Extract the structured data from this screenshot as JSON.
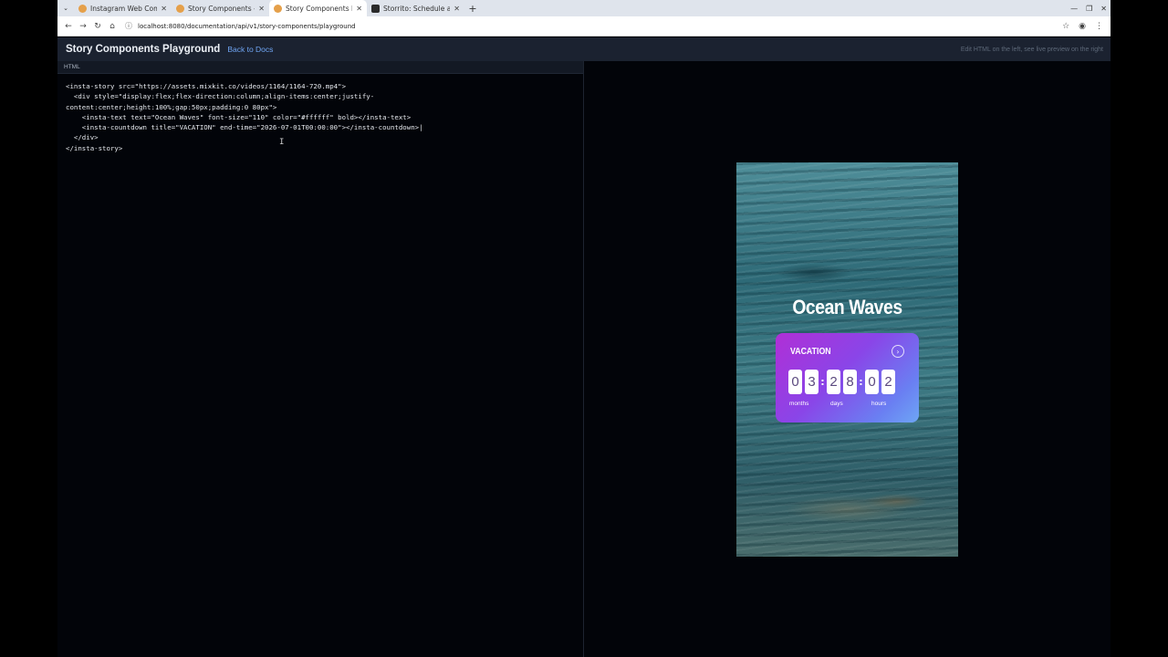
{
  "browser": {
    "tabs": [
      {
        "title": "Instagram Web Comp",
        "favicon": "instagram-icon"
      },
      {
        "title": "Story Components - S",
        "favicon": "instagram-icon"
      },
      {
        "title": "Story Components Pl",
        "favicon": "instagram-icon",
        "active": true
      },
      {
        "title": "Storrito: Schedule an",
        "favicon": "storrito-icon"
      }
    ],
    "url": "localhost:8080/documentation/api/v1/story-components/playground"
  },
  "header": {
    "title": "Story Components Playground",
    "back_link": "Back to Docs",
    "hint": "Edit HTML on the left, see live preview on the right"
  },
  "editor": {
    "label": "HTML",
    "code": "<insta-story src=\"https://assets.mixkit.co/videos/1164/1164-720.mp4\">\n  <div style=\"display:flex;flex-direction:column;align-items:center;justify-\ncontent:center;height:100%;gap:50px;padding:0 80px\">\n    <insta-text text=\"Ocean Waves\" font-size=\"110\" color=\"#ffffff\" bold></insta-text>\n    <insta-countdown title=\"VACATION\" end-time=\"2026-07-01T00:00:00\"></insta-countdown>|\n  </div>\n</insta-story>"
  },
  "preview": {
    "story_title": "Ocean Waves",
    "countdown": {
      "title": "VACATION",
      "digits": [
        "0",
        "3",
        "2",
        "8",
        "0",
        "2"
      ],
      "units": [
        "months",
        "days",
        "hours"
      ]
    }
  }
}
